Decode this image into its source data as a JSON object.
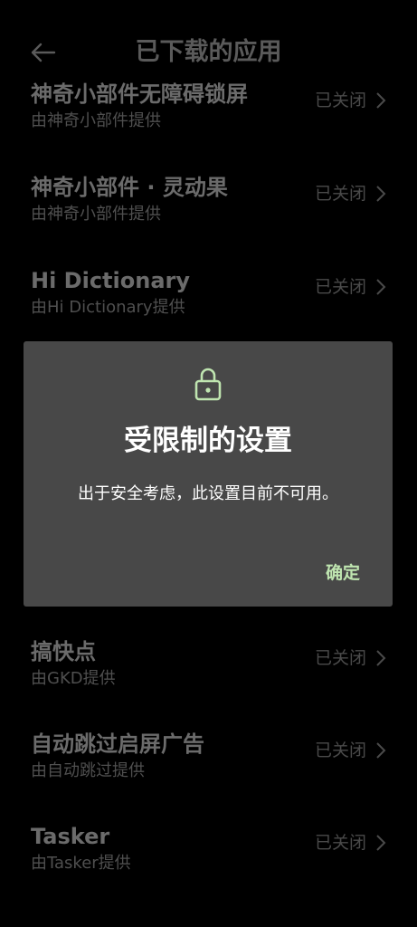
{
  "header": {
    "title": "已下载的应用",
    "back_icon": "arrow-left-icon"
  },
  "apps": [
    {
      "name": "神奇小部件无障碍锁屏",
      "provider": "由神奇小部件提供",
      "status": "已关闭"
    },
    {
      "name": "神奇小部件 · 灵动果",
      "provider": "由神奇小部件提供",
      "status": "已关闭"
    },
    {
      "name": "Hi Dictionary",
      "provider": "由Hi Dictionary提供",
      "status": "已关闭"
    },
    {
      "name": "搞快点",
      "provider": "由GKD提供",
      "status": "已关闭"
    },
    {
      "name": "自动跳过启屏广告",
      "provider": "由自动跳过提供",
      "status": "已关闭"
    },
    {
      "name": "Tasker",
      "provider": "由Tasker提供",
      "status": "已关闭"
    }
  ],
  "dialog": {
    "icon": "lock-icon",
    "title": "受限制的设置",
    "message": "出于安全考虑，此设置目前不可用。",
    "ok_label": "确定"
  },
  "colors": {
    "background": "#000000",
    "dialog_background": "#484848",
    "accent": "#bfe5b0"
  }
}
